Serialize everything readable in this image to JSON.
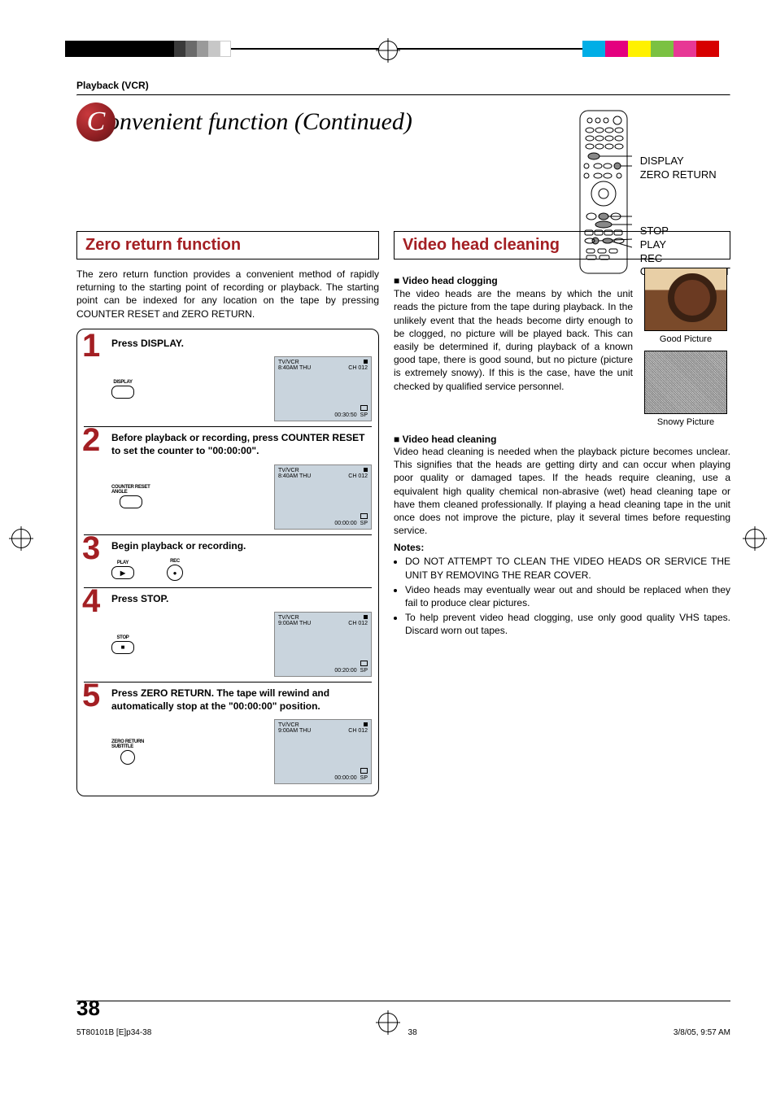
{
  "breadcrumb": "Playback (VCR)",
  "title": {
    "ball": "C",
    "rest": "onvenient function (Continued)"
  },
  "remote_labels": {
    "display": "DISPLAY",
    "zero_return": "ZERO RETURN",
    "stop": "STOP",
    "play": "PLAY",
    "rec": "REC",
    "counter_reset": "COUNTER RESET"
  },
  "left": {
    "section_title": "Zero return function",
    "intro": "The zero return function provides a convenient method of rapidly returning to the starting point of recording or playback. The starting point can be indexed for any location on the tape by pressing COUNTER RESET and ZERO RETURN.",
    "steps": [
      {
        "num": "1",
        "text": "Press DISPLAY.",
        "buttons": [
          {
            "label": "DISPLAY",
            "shape": "oval",
            "glyph": ""
          }
        ],
        "osd": {
          "mode": "TV/VCR",
          "time": "8:40AM  THU",
          "ch": "CH 012",
          "counter": "00:30:50",
          "speed": "SP"
        }
      },
      {
        "num": "2",
        "text": "Before playback or recording, press COUNTER RESET to set the counter to \"00:00:00\".",
        "buttons": [
          {
            "label": "COUNTER RESET\nANGLE",
            "shape": "oval",
            "glyph": ""
          }
        ],
        "osd": {
          "mode": "TV/VCR",
          "time": "8:40AM  THU",
          "ch": "CH 012",
          "counter": "00:00:00",
          "speed": "SP"
        }
      },
      {
        "num": "3",
        "text": "Begin playback or recording.",
        "buttons": [
          {
            "label": "PLAY",
            "shape": "oval",
            "glyph": "▶"
          },
          {
            "label": "REC",
            "shape": "round",
            "glyph": "●"
          }
        ],
        "osd": null
      },
      {
        "num": "4",
        "text": "Press STOP.",
        "buttons": [
          {
            "label": "STOP",
            "shape": "oval",
            "glyph": "■"
          }
        ],
        "osd": {
          "mode": "TV/VCR",
          "time": "9:00AM  THU",
          "ch": "CH 012",
          "counter": "00:20:00",
          "speed": "SP"
        }
      },
      {
        "num": "5",
        "text": "Press ZERO RETURN. The tape will rewind and automatically stop at the \"00:00:00\" position.",
        "buttons": [
          {
            "label": "ZERO RETURN\nSUBTITLE",
            "shape": "round",
            "glyph": ""
          }
        ],
        "osd": {
          "mode": "TV/VCR",
          "time": "9:00AM  THU",
          "ch": "CH 012",
          "counter": "00:00:00",
          "speed": "SP"
        }
      }
    ]
  },
  "right": {
    "section_title": "Video head cleaning",
    "clogging_title": "Video head clogging",
    "clogging_text": "The video heads are the means by which the unit reads the picture from the tape during playback. In the unlikely event that the heads become dirty enough to be clogged, no picture will be played back. This can easily be determined if, during playback of a known good tape, there is good sound, but no picture (picture is extremely snowy). If this is the case, have the unit checked by qualified service personnel.",
    "good_picture_caption": "Good Picture",
    "snowy_picture_caption": "Snowy Picture",
    "cleaning_title": "Video head cleaning",
    "cleaning_text": "Video head cleaning is needed when the playback picture becomes unclear. This signifies that the heads are getting dirty and can occur when playing poor quality or damaged tapes. If the heads require cleaning, use a equivalent high quality chemical non-abrasive (wet) head cleaning tape or have them cleaned professionally. If playing a head cleaning tape in the unit once does not improve the picture, play it several times before requesting service.",
    "notes_title": "Notes:",
    "notes": [
      "DO NOT ATTEMPT TO CLEAN THE VIDEO HEADS OR SERVICE THE UNIT BY REMOVING THE REAR COVER.",
      "Video heads may eventually wear out and should be replaced when they fail to produce clear pictures.",
      "To help prevent video head clogging, use only good quality VHS tapes. Discard worn out tapes."
    ]
  },
  "page_number": "38",
  "footer": {
    "file": "5T80101B [E]p34-38",
    "page": "38",
    "date": "3/8/05, 9:57 AM"
  }
}
